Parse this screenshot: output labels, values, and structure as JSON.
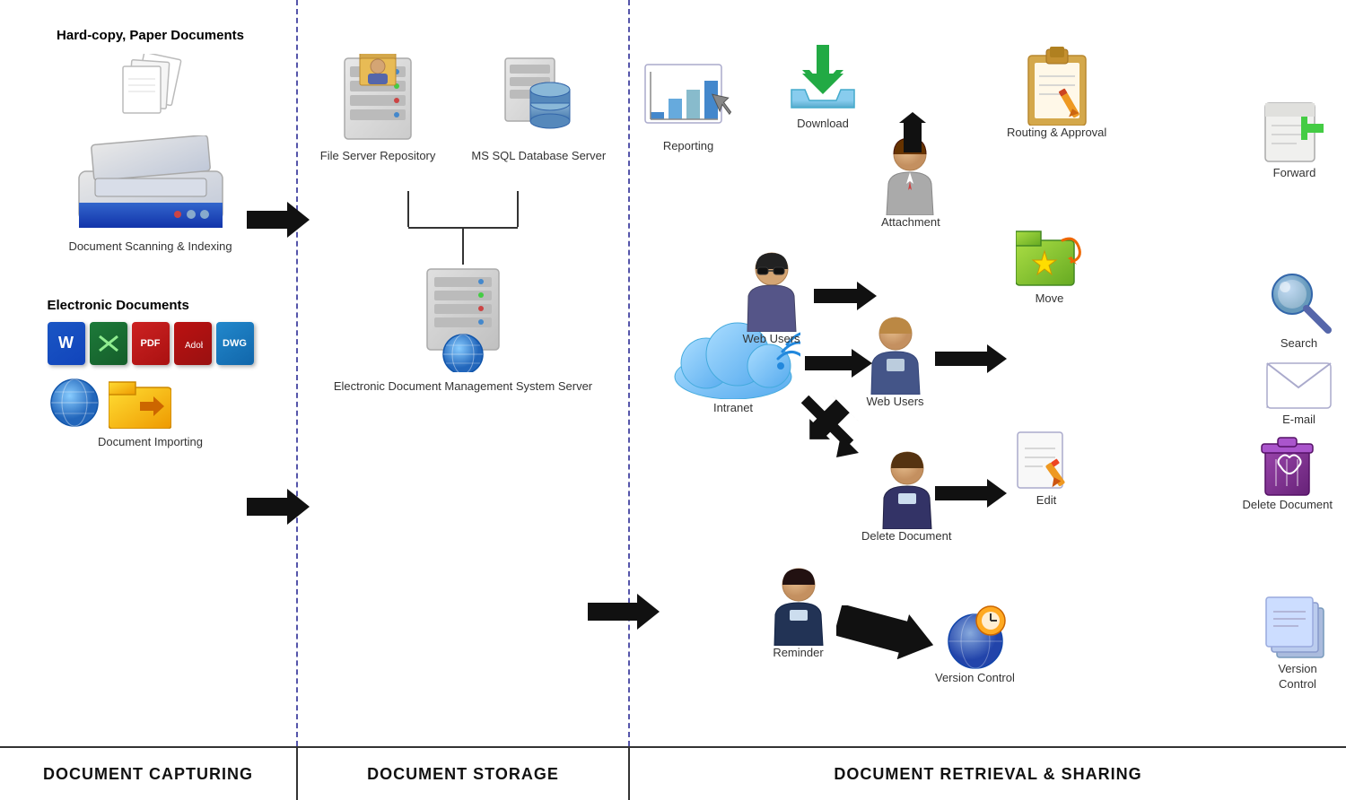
{
  "sections": {
    "capture": {
      "title": "DOCUMENT CAPTURING",
      "hardcopy_label": "Hard-copy,\nPaper Documents",
      "scanning_label": "Document Scanning\n& Indexing",
      "electronic_label": "Electronic Documents",
      "importing_label": "Document Importing"
    },
    "storage": {
      "title": "DOCUMENT STORAGE",
      "fileserver_label": "File Server\nRepository",
      "database_label": "MS SQL\nDatabase Server",
      "edms_label": "Electronic Document\nManagement System Server"
    },
    "retrieval": {
      "title": "DOCUMENT RETRIEVAL & SHARING",
      "items": [
        {
          "id": "reporting",
          "label": "Reporting"
        },
        {
          "id": "download",
          "label": "Download"
        },
        {
          "id": "attachment",
          "label": "Attachment"
        },
        {
          "id": "routing",
          "label": "Routing &\nApproval"
        },
        {
          "id": "forward",
          "label": "Forward"
        },
        {
          "id": "web_users_1",
          "label": "Web\nUsers"
        },
        {
          "id": "web_users_2",
          "label": "Web\nUsers"
        },
        {
          "id": "move",
          "label": "Move"
        },
        {
          "id": "search",
          "label": "Search"
        },
        {
          "id": "intranet",
          "label": "Intranet"
        },
        {
          "id": "web_users_3",
          "label": "Web\nUsers"
        },
        {
          "id": "email",
          "label": "E-mail"
        },
        {
          "id": "delete",
          "label": "Delete\nDocument"
        },
        {
          "id": "edit",
          "label": "Edit"
        },
        {
          "id": "web_users_4",
          "label": "Web\nUsers"
        },
        {
          "id": "reminder",
          "label": "Reminder"
        },
        {
          "id": "version",
          "label": "Version\nControl"
        }
      ]
    }
  }
}
